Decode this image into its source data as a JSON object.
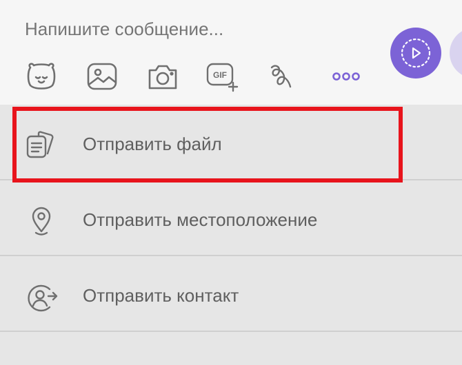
{
  "compose": {
    "placeholder": "Напишите сообщение...",
    "toolbar": [
      {
        "icon": "sticker-bear-icon"
      },
      {
        "icon": "gallery-icon"
      },
      {
        "icon": "camera-icon"
      },
      {
        "icon": "gif-add-icon",
        "text": "GIF"
      },
      {
        "icon": "doodle-icon"
      },
      {
        "icon": "more-dots-icon"
      }
    ],
    "send_icon": "video-message-icon"
  },
  "menu": {
    "items": [
      {
        "label": "Отправить файл",
        "icon": "file-icon"
      },
      {
        "label": "Отправить местоположение",
        "icon": "location-pin-icon"
      },
      {
        "label": "Отправить контакт",
        "icon": "contact-share-icon"
      }
    ]
  },
  "colors": {
    "accent": "#7c63d6",
    "highlight": "#e8141c",
    "icon": "#6f6f6f",
    "text": "#5f5f5f",
    "placeholder": "#8f8f8f"
  }
}
